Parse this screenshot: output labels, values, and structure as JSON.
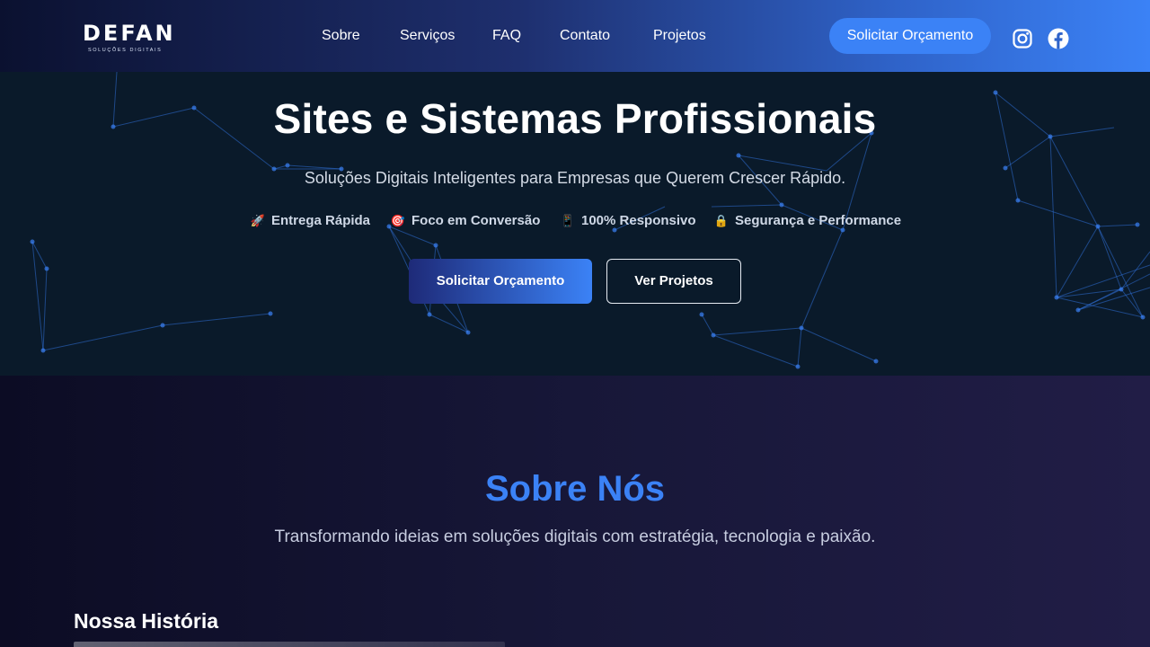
{
  "brand": {
    "name": "DEFAN",
    "tagline": "SOLUÇÕES DIGITAIS"
  },
  "nav": {
    "links": [
      "Sobre",
      "Serviços",
      "FAQ",
      "Contato",
      "Projetos"
    ],
    "cta": "Solicitar Orçamento",
    "social": [
      "instagram-icon",
      "facebook-icon"
    ]
  },
  "hero": {
    "title": "Sites e Sistemas Profissionais",
    "subtitle": "Soluções Digitais Inteligentes para Empresas que Querem Crescer Rápido.",
    "features": [
      {
        "icon": "🚀",
        "label": "Entrega Rápida"
      },
      {
        "icon": "🎯",
        "label": "Foco em Conversão"
      },
      {
        "icon": "📱",
        "label": "100% Responsivo"
      },
      {
        "icon": "🔒",
        "label": "Segurança e Performance"
      }
    ],
    "primary_button": "Solicitar Orçamento",
    "secondary_button": "Ver Projetos"
  },
  "about": {
    "title": "Sobre Nós",
    "subtitle": "Transformando ideias em soluções digitais com estratégia, tecnologia e paixão.",
    "history_title": "Nossa História"
  },
  "colors": {
    "accent": "#3b82f6",
    "hero_bg": "#0a1a2a",
    "about_bg": "#171738",
    "network_line": "#2f6fd6"
  }
}
